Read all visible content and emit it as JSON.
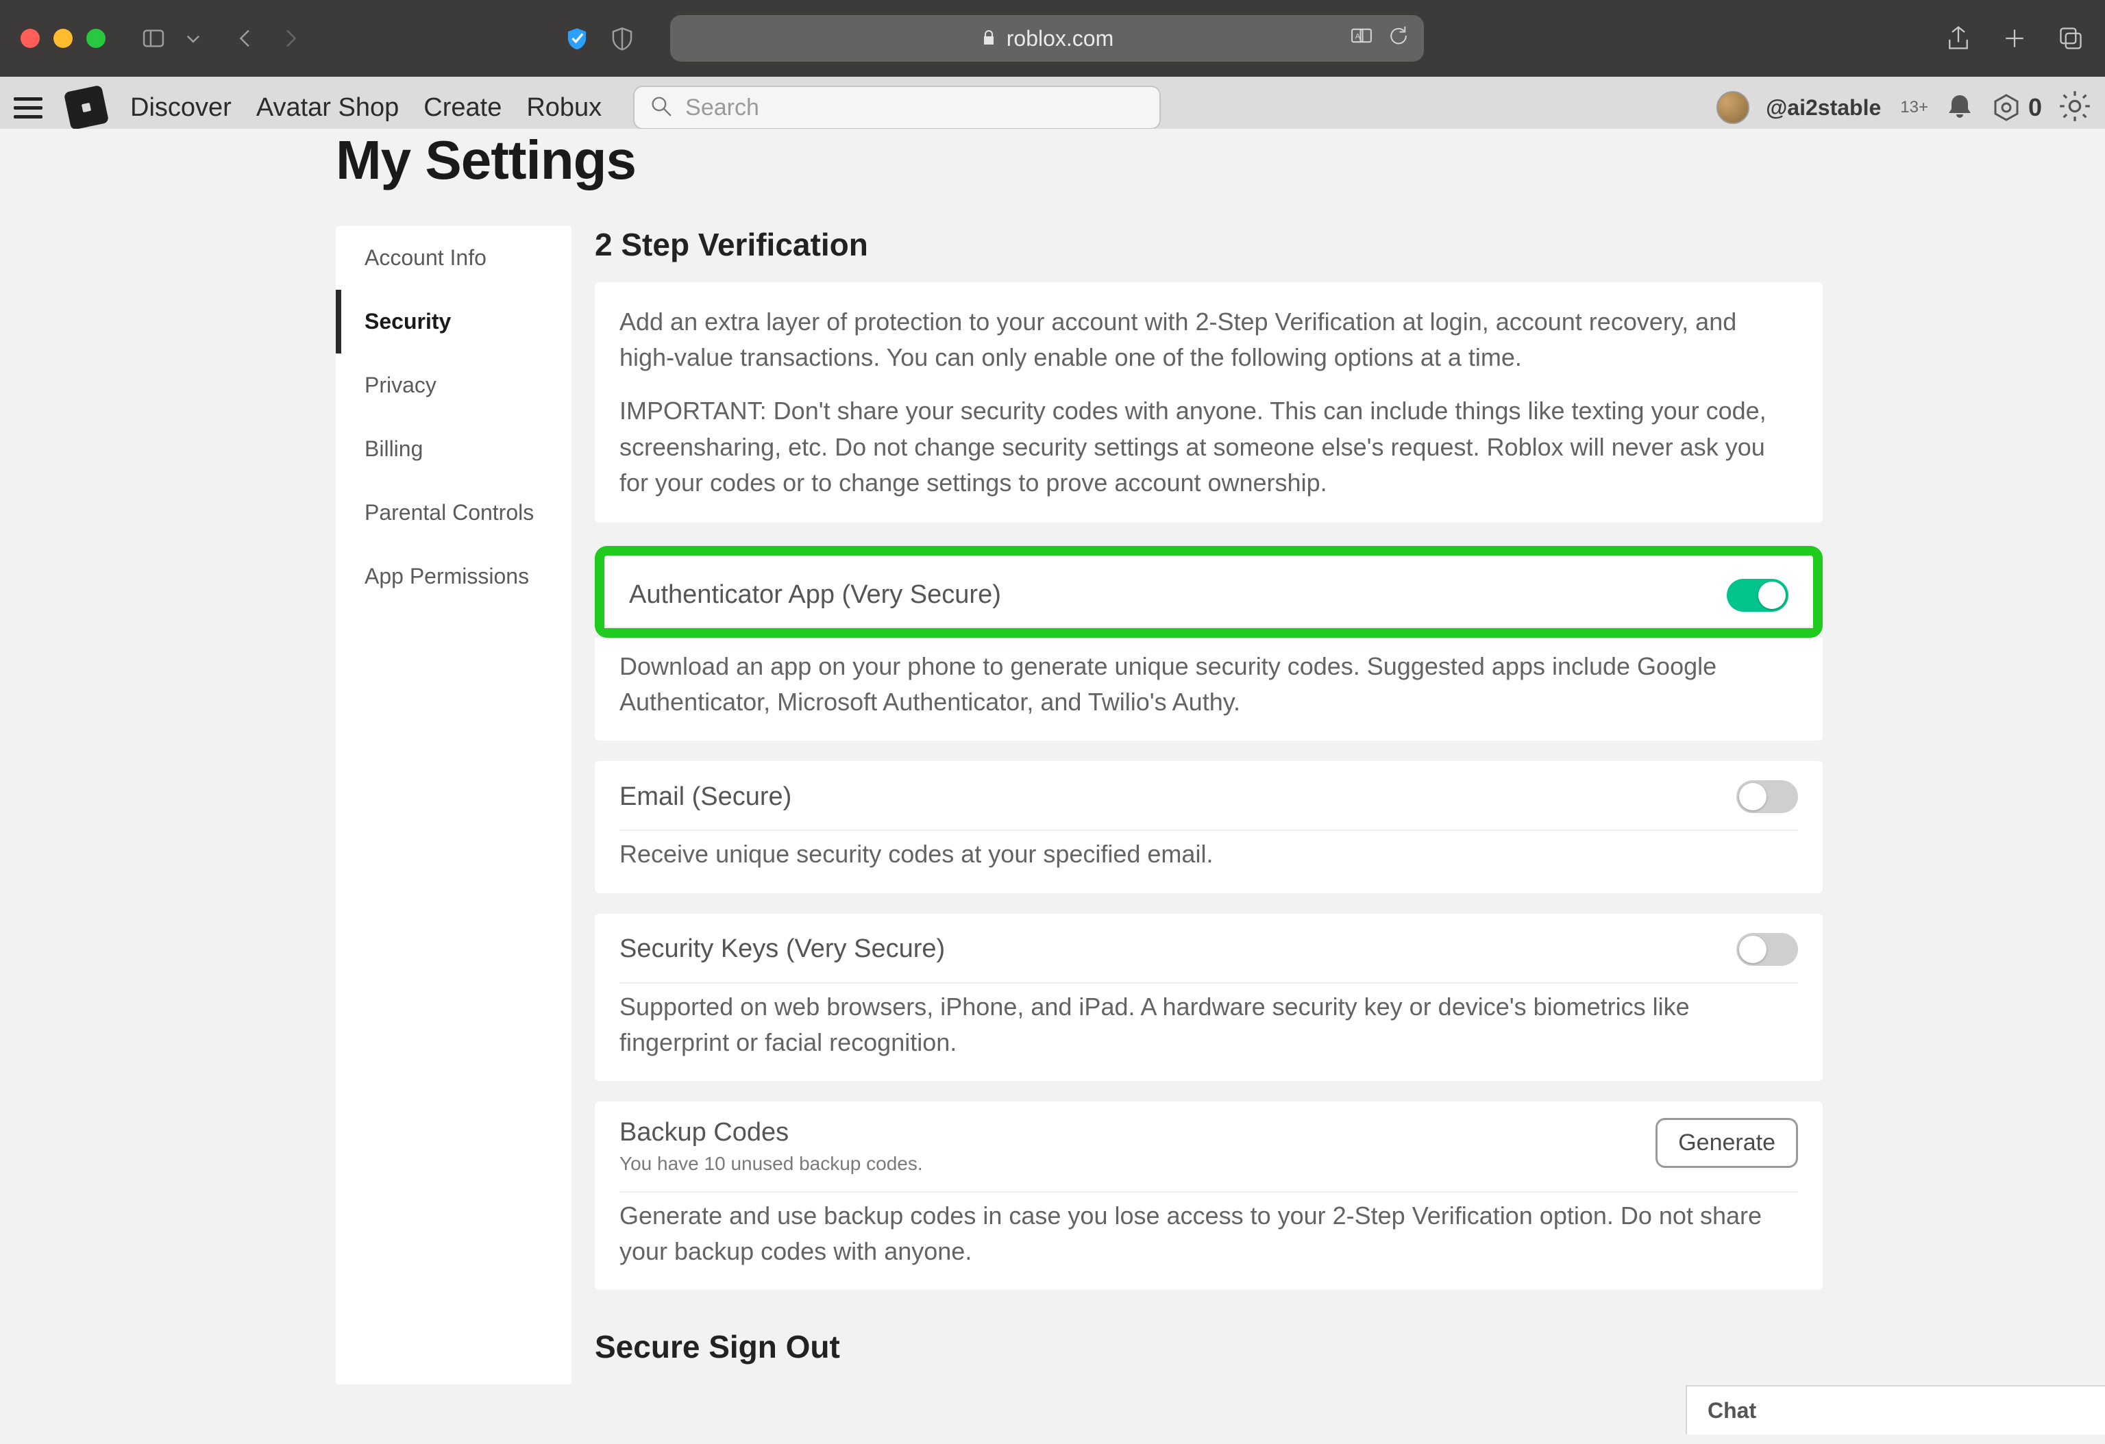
{
  "browser": {
    "url": "roblox.com"
  },
  "nav": {
    "links": [
      "Discover",
      "Avatar Shop",
      "Create",
      "Robux"
    ],
    "search_placeholder": "Search",
    "username": "@ai2stable",
    "age_badge": "13+",
    "robux_count": "0"
  },
  "page_title": "My Settings",
  "sidebar": {
    "items": [
      "Account Info",
      "Security",
      "Privacy",
      "Billing",
      "Parental Controls",
      "App Permissions"
    ],
    "active_index": 1
  },
  "section_title": "2 Step Verification",
  "intro": {
    "p1": "Add an extra layer of protection to your account with 2-Step Verification at login, account recovery, and high-value transactions. You can only enable one of the following options at a time.",
    "p2": "IMPORTANT: Don't share your security codes with anyone. This can include things like texting your code, screensharing, etc. Do not change security settings at someone else's request. Roblox will never ask you for your codes or to change settings to prove account ownership."
  },
  "options": {
    "authenticator": {
      "title": "Authenticator App (Very Secure)",
      "enabled": true,
      "desc": "Download an app on your phone to generate unique security codes. Suggested apps include Google Authenticator, Microsoft Authenticator, and Twilio's Authy."
    },
    "email": {
      "title": "Email (Secure)",
      "enabled": false,
      "desc": "Receive unique security codes at your specified email."
    },
    "security_keys": {
      "title": "Security Keys (Very Secure)",
      "enabled": false,
      "desc": "Supported on web browsers, iPhone, and iPad. A hardware security key or device's biometrics like fingerprint or facial recognition."
    },
    "backup": {
      "title": "Backup Codes",
      "sub": "You have 10 unused backup codes.",
      "button": "Generate",
      "desc": "Generate and use backup codes in case you lose access to your 2-Step Verification option. Do not share your backup codes with anyone."
    }
  },
  "signout_title": "Secure Sign Out",
  "chat_label": "Chat"
}
